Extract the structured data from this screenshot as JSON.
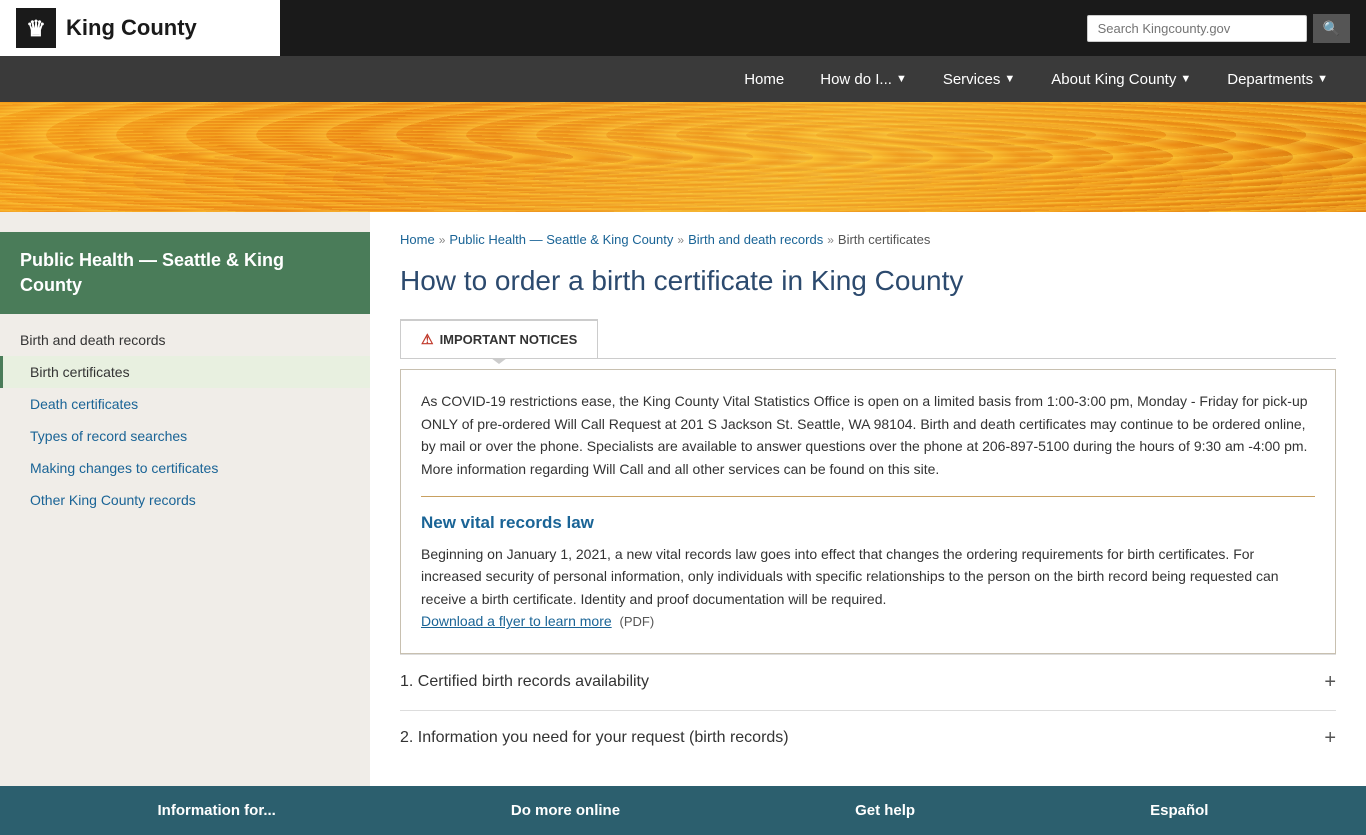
{
  "header": {
    "logo_text": "King County",
    "search_placeholder": "Search Kingcounty.gov",
    "nav": [
      {
        "label": "Home",
        "has_caret": false
      },
      {
        "label": "How do I...",
        "has_caret": true
      },
      {
        "label": "Services",
        "has_caret": true
      },
      {
        "label": "About King County",
        "has_caret": true
      },
      {
        "label": "Departments",
        "has_caret": true
      }
    ]
  },
  "sidebar": {
    "title": "Public Health — Seattle & King County",
    "section_title": "Birth and death records",
    "items": [
      {
        "label": "Birth certificates",
        "active": true
      },
      {
        "label": "Death certificates",
        "active": false
      },
      {
        "label": "Types of record searches",
        "active": false
      },
      {
        "label": "Making changes to certificates",
        "active": false
      },
      {
        "label": "Other King County records",
        "active": false
      }
    ]
  },
  "breadcrumb": {
    "items": [
      {
        "label": "Home",
        "link": true
      },
      {
        "label": "Public Health — Seattle & King County",
        "link": true
      },
      {
        "label": "Birth and death records",
        "link": true
      },
      {
        "label": "Birth certificates",
        "link": false
      }
    ]
  },
  "page_title": "How to order a birth certificate in King County",
  "tab": {
    "label": "IMPORTANT NOTICES"
  },
  "notice": {
    "covid_text": "As COVID-19 restrictions ease, the King County Vital Statistics Office is open on a limited basis from 1:00-3:00 pm, Monday - Friday for pick-up ONLY of pre-ordered Will Call Request at 201 S Jackson St. Seattle, WA 98104. Birth and death certificates may continue to be ordered online, by mail or over the phone. Specialists are available to answer questions over the phone at 206-897-5100 during the hours of 9:30 am -4:00 pm. More information regarding Will Call and all other services can be found on this site.",
    "subtitle": "New vital records law",
    "body": "Beginning on January 1, 2021, a new vital records law goes into effect that changes the ordering requirements for birth certificates. For increased security of personal information, only individuals with specific relationships to the person on the birth record being requested can receive a birth certificate. Identity and proof documentation will be required.",
    "link_text": "Download a flyer to learn more",
    "link_suffix": "(PDF)"
  },
  "accordions": [
    {
      "label": "1. Certified birth records availability"
    },
    {
      "label": "2. Information you need for your request (birth records)"
    }
  ],
  "footer": {
    "items": [
      {
        "label": "Information for..."
      },
      {
        "label": "Do more online"
      },
      {
        "label": "Get help"
      },
      {
        "label": "Español"
      }
    ]
  }
}
